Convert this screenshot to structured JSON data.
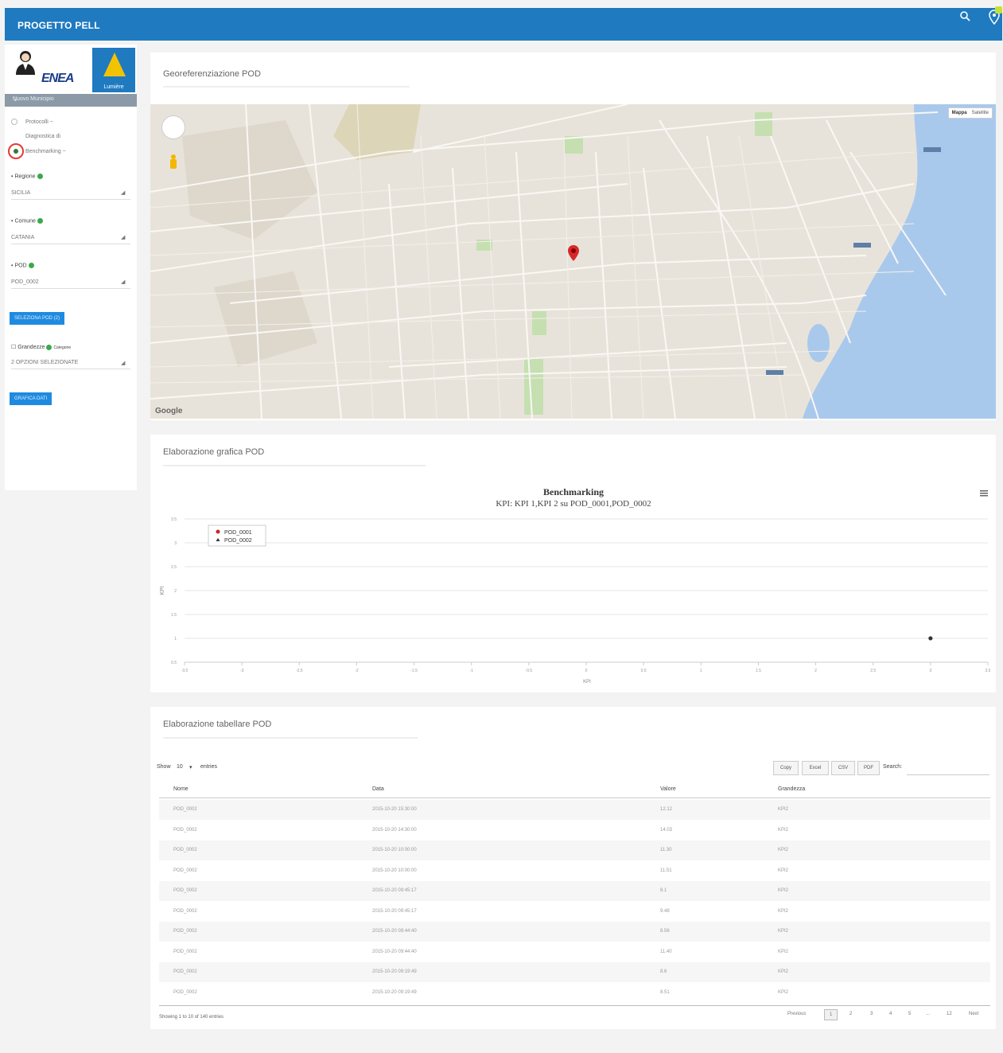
{
  "app": {
    "title": "PROGETTO PELL"
  },
  "sidebar": {
    "enea": "ENEA",
    "lumiere": "Lumière",
    "user_bar": "Nuovo Municipio",
    "menu": [
      {
        "label": "Protocolli ~"
      },
      {
        "label": "Diagnostica di"
      },
      {
        "label": "Benchmarking ~"
      }
    ],
    "fields": [
      {
        "label": "Regione",
        "value": "SICILIA"
      },
      {
        "label": "Comune",
        "value": "CATANIA"
      },
      {
        "label": "POD",
        "value": "POD_0002"
      }
    ],
    "select_btn": "SELEZIONA POD (2)",
    "grandezze_label": "Grandezze",
    "grandezze_extra": "Categorie",
    "grandezze_value": "2 OPZIONI SELEZIONATE",
    "view_btn": "GRAFICA DATI"
  },
  "map_card": {
    "title": "Georeferenziazione POD",
    "map_btn": "Mappa",
    "sat_btn": "Satellite",
    "google": "Google"
  },
  "chart_card": {
    "title": "Elaborazione grafica POD"
  },
  "chart_data": {
    "type": "scatter",
    "title": "Benchmarking",
    "subtitle": "KPI: KPI 1,KPI 2 su POD_0001,POD_0002",
    "series": [
      {
        "name": "POD_0001",
        "color": "#c62828",
        "points": [
          [
            3,
            1
          ]
        ]
      },
      {
        "name": "POD_0002",
        "color": "#333333",
        "points": [
          [
            3,
            1
          ]
        ]
      }
    ],
    "x_ticks": [
      "-3.5",
      "-3",
      "-2.5",
      "-2",
      "-1.5",
      "-1",
      "-0.5",
      "0",
      "0.5",
      "1",
      "1.5",
      "2",
      "2.5",
      "3",
      "3.5"
    ],
    "y_ticks": [
      "3.5",
      "3",
      "2.5",
      "2",
      "1.5",
      "1",
      "0.5"
    ],
    "xlim": [
      -3.5,
      3.5
    ],
    "ylim": [
      0.5,
      3.5
    ],
    "xlabel": "KPI",
    "ylabel": "KPI"
  },
  "table_card": {
    "title": "Elaborazione tabellare POD",
    "show_label": "Show",
    "show_value": "10",
    "entries_label": "entries",
    "buttons": [
      "Copy",
      "Excel",
      "CSV",
      "PDF"
    ],
    "search_label": "Search:",
    "columns": [
      "Nome",
      "Data",
      "Valore",
      "Grandezza"
    ],
    "rows": [
      [
        "POD_0002",
        "2015-10-20 15:30:00",
        "12.12",
        "KPI2"
      ],
      [
        "POD_0002",
        "2015-10-20 14:30:00",
        "14.03",
        "KPI2"
      ],
      [
        "POD_0002",
        "2015-10-20 10:00:00",
        "11.30",
        "KPI2"
      ],
      [
        "POD_0002",
        "2015-10-20 10:00:00",
        "11.51",
        "KPI2"
      ],
      [
        "POD_0002",
        "2015-10-20 09:45:17",
        "8.1",
        "KPI2"
      ],
      [
        "POD_0002",
        "2015-10-20 09:45:17",
        "9.48",
        "KPI2"
      ],
      [
        "POD_0002",
        "2015-10-20 09:44:40",
        "8.56",
        "KPI2"
      ],
      [
        "POD_0002",
        "2015-10-20 09:44:40",
        "11.40",
        "KPI2"
      ],
      [
        "POD_0002",
        "2015-10-20 09:19:49",
        "8.6",
        "KPI2"
      ],
      [
        "POD_0002",
        "2015-10-20 09:19:49",
        "8.51",
        "KPI2"
      ]
    ],
    "footer": "Showing 1 to 10 of 140 entries",
    "pagination": [
      "Previous",
      "1",
      "2",
      "3",
      "4",
      "5",
      "...",
      "12",
      "Next"
    ]
  }
}
